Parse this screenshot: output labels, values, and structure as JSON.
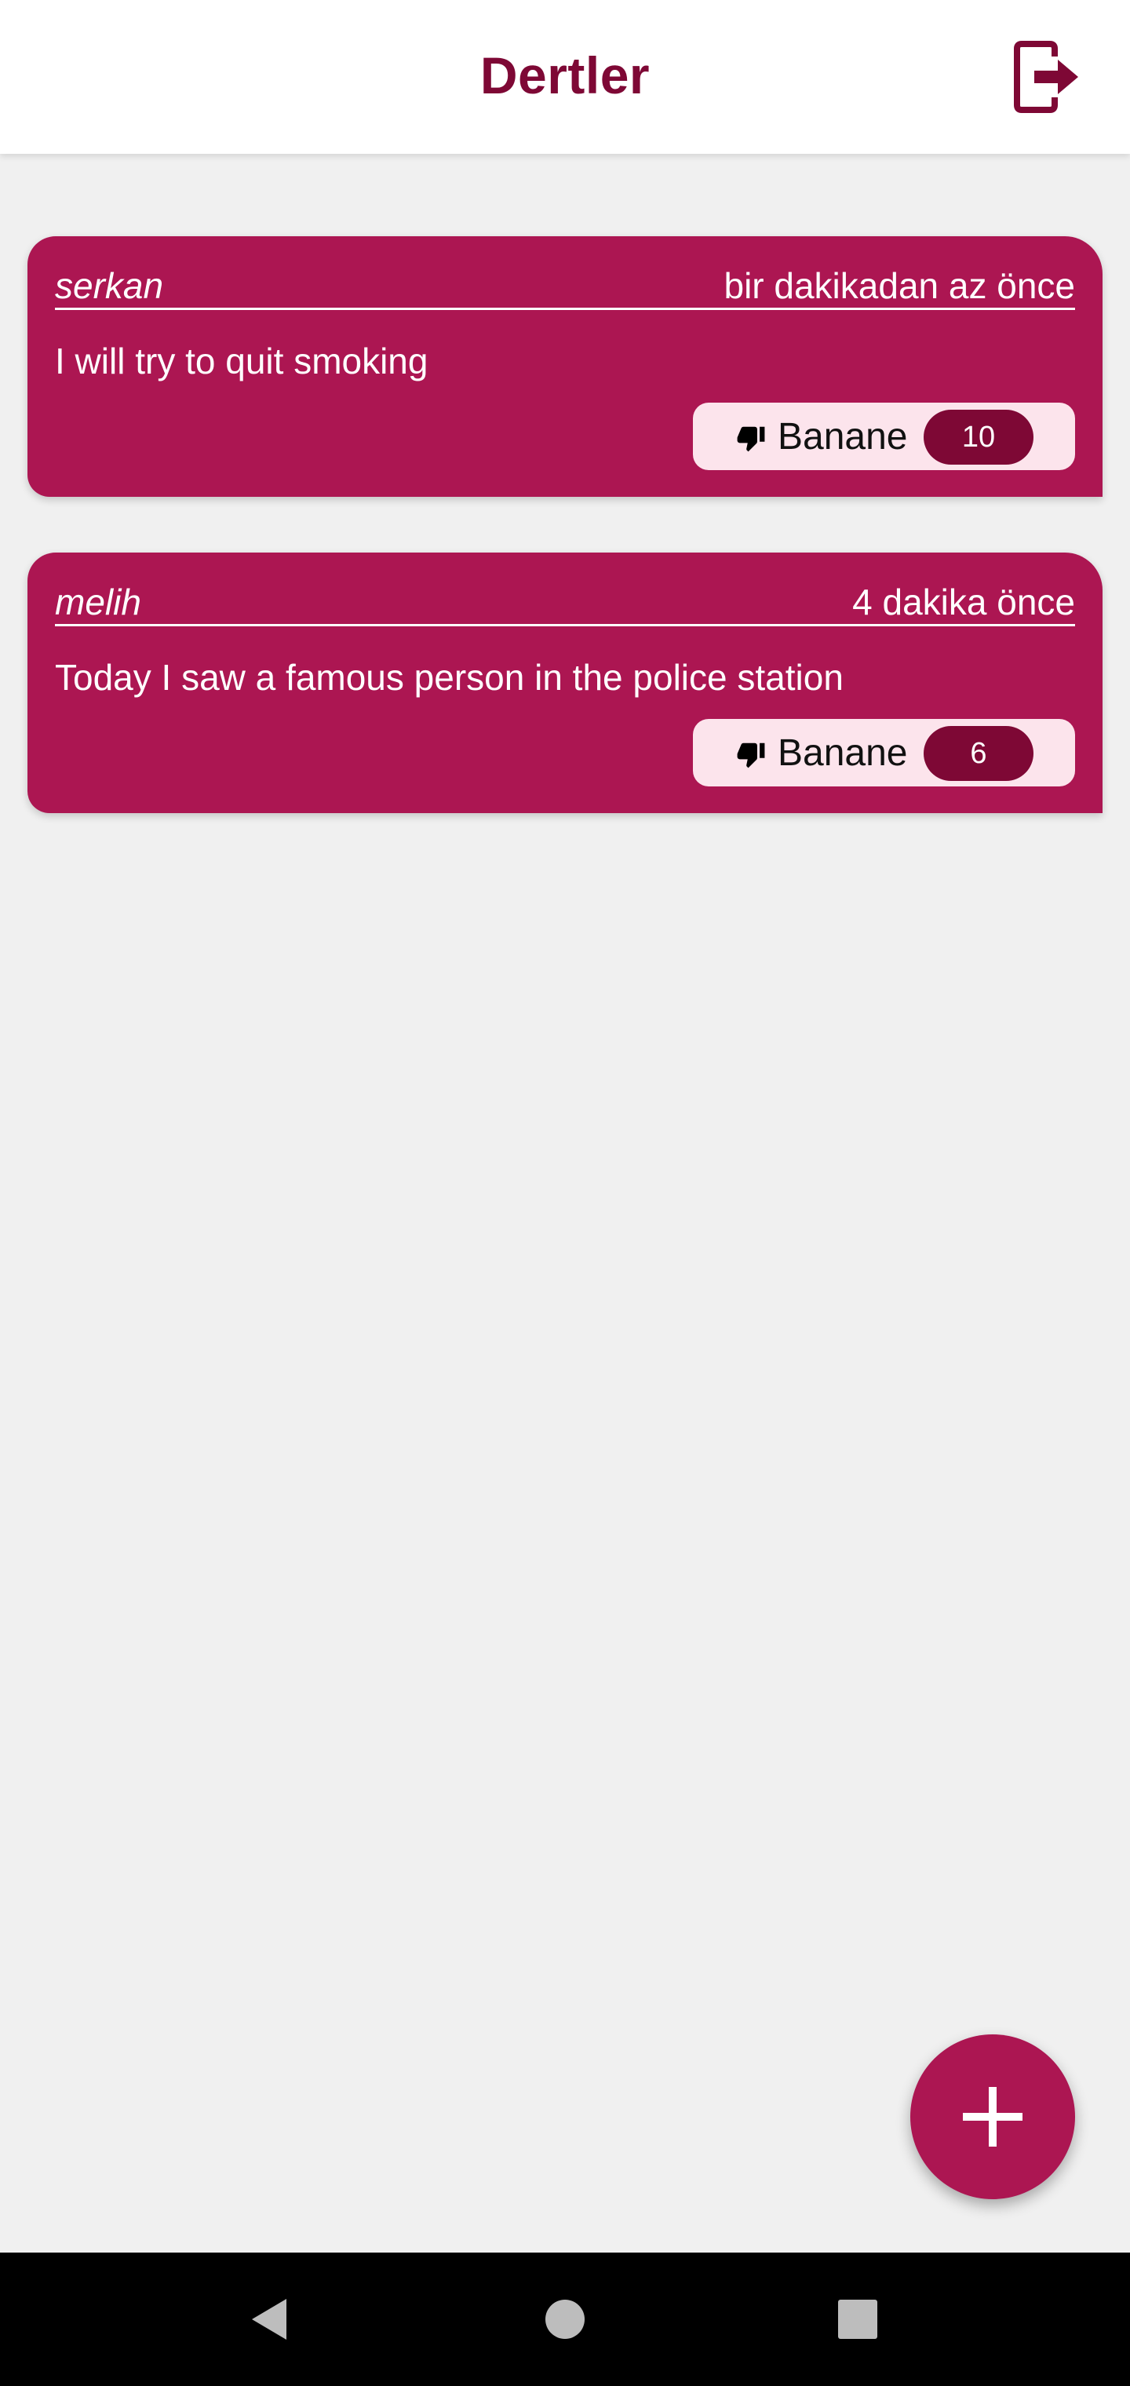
{
  "app_bar": {
    "title": "Dertler",
    "logout_icon": "logout-icon"
  },
  "posts": [
    {
      "author": "serkan",
      "time": "bir dakikadan az önce",
      "text": "I will try to quit smoking",
      "reaction_label": "Banane",
      "reaction_icon": "thumbs-down-icon",
      "count": "10"
    },
    {
      "author": "melih",
      "time": "4 dakika önce",
      "text": "Today I saw a famous person in the police station",
      "reaction_label": "Banane",
      "reaction_icon": "thumbs-down-icon",
      "count": "6"
    }
  ],
  "fab": {
    "icon": "plus-icon"
  },
  "nav": {
    "back_icon": "back-icon",
    "home_icon": "home-icon",
    "recents_icon": "recents-icon"
  },
  "colors": {
    "primary": "#ac1652",
    "primary_dark": "#7e0835",
    "button_bg": "#fce4ec",
    "background": "#f0f0f0"
  }
}
